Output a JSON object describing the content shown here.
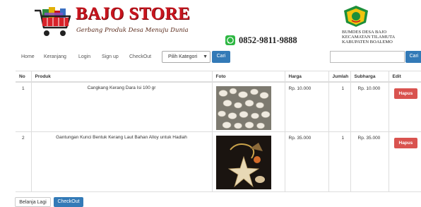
{
  "brand": {
    "name": "BAJO STORE",
    "tagline": "Gerbang Produk Desa Menuju Dunia",
    "phone": "0852-9811-9888",
    "org_lines": [
      "BUMDES DESA BAJO",
      "KECAMATAN TILAMUTA",
      "KABUPATEN BOALEMO"
    ]
  },
  "nav": {
    "items": [
      "Home",
      "Keranjang",
      "Login",
      "Sign up",
      "CheckOut"
    ],
    "category_select": "Pilih Kategori",
    "search_button": "Cari",
    "search_placeholder": "",
    "search_button_right": "Cari"
  },
  "table": {
    "headers": [
      "No",
      "Produk",
      "Foto",
      "Harga",
      "Jumlah",
      "Subharga",
      "Edit"
    ],
    "rows": [
      {
        "no": "1",
        "product": "Cangkang Kerang Dara Isi 100 gr",
        "price": "Rp. 10.000",
        "qty": "1",
        "subtotal": "Rp. 10.000",
        "action": "Hapus"
      },
      {
        "no": "2",
        "product": "Gantungan Kunci Bentuk Kerang Laut Bahan Alloy untuk Hadiah",
        "price": "Rp. 35.000",
        "qty": "1",
        "subtotal": "Rp. 35.000",
        "action": "Hapus"
      }
    ]
  },
  "footer": {
    "continue_label": "Belanja Lagi",
    "checkout_label": "CheckOut"
  },
  "colors": {
    "brand_red": "#c8151e",
    "primary_blue": "#337ab7",
    "danger_red": "#d9534f"
  },
  "icons": [
    "shopping-cart-logo",
    "whatsapp-icon",
    "bumdes-emblem",
    "chevron-down-icon"
  ]
}
